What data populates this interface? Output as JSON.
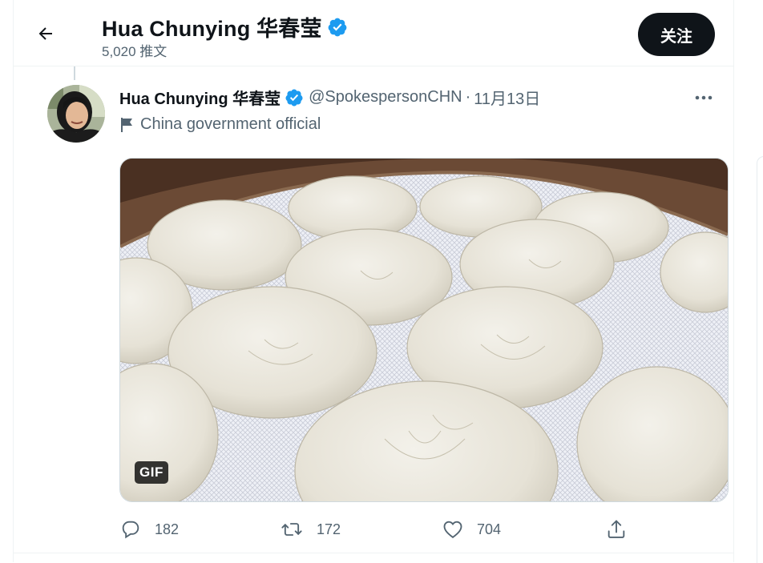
{
  "header": {
    "name": "Hua Chunying 华春莹",
    "tweet_count": "5,020 推文",
    "follow_label": "关注"
  },
  "tweet": {
    "name": "Hua Chunying 华春莹",
    "handle": "@SpokespersonCHN",
    "separator": "·",
    "date": "11月13日",
    "label": "China government official",
    "media_badge": "GIF",
    "replies": "182",
    "retweets": "172",
    "likes": "704"
  },
  "icons": {
    "back": "back-arrow-icon",
    "verified": "verified-badge-icon",
    "more": "more-horizontal-icon",
    "flag": "government-flag-icon",
    "reply": "reply-icon",
    "retweet": "retweet-icon",
    "like": "like-icon",
    "share": "share-icon"
  },
  "colors": {
    "verified": "#1d9bf0",
    "text_primary": "#0f1419",
    "text_secondary": "#536471",
    "follow_bg": "#0f1419"
  }
}
